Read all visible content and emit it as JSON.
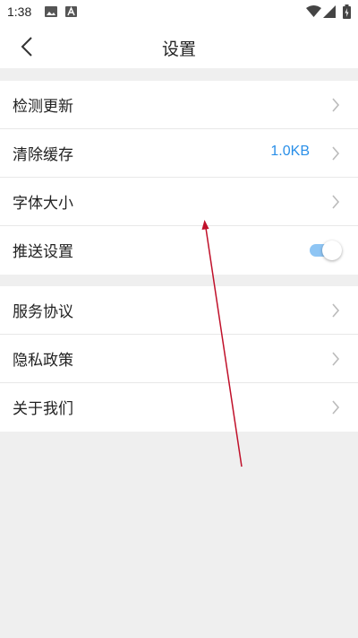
{
  "status_bar": {
    "time": "1:38",
    "icons": [
      "image-icon",
      "text-a-icon",
      "wifi-icon",
      "signal-icon",
      "battery-charging-icon"
    ]
  },
  "header": {
    "title": "设置",
    "back_icon": "chevron-left-icon"
  },
  "settings": {
    "group1": [
      {
        "label": "检测更新",
        "value": "",
        "control": "chevron"
      },
      {
        "label": "清除缓存",
        "value": "1.0KB",
        "control": "chevron"
      },
      {
        "label": "字体大小",
        "value": "",
        "control": "chevron"
      },
      {
        "label": "推送设置",
        "value": "",
        "control": "toggle",
        "toggle_on": true
      }
    ],
    "group2": [
      {
        "label": "服务协议",
        "control": "chevron"
      },
      {
        "label": "隐私政策",
        "control": "chevron"
      },
      {
        "label": "关于我们",
        "control": "chevron"
      }
    ]
  },
  "colors": {
    "accent": "#2a8fe8",
    "toggle_track": "#8ec5f4",
    "background": "#efefef",
    "annotation_arrow": "#c0102a"
  }
}
